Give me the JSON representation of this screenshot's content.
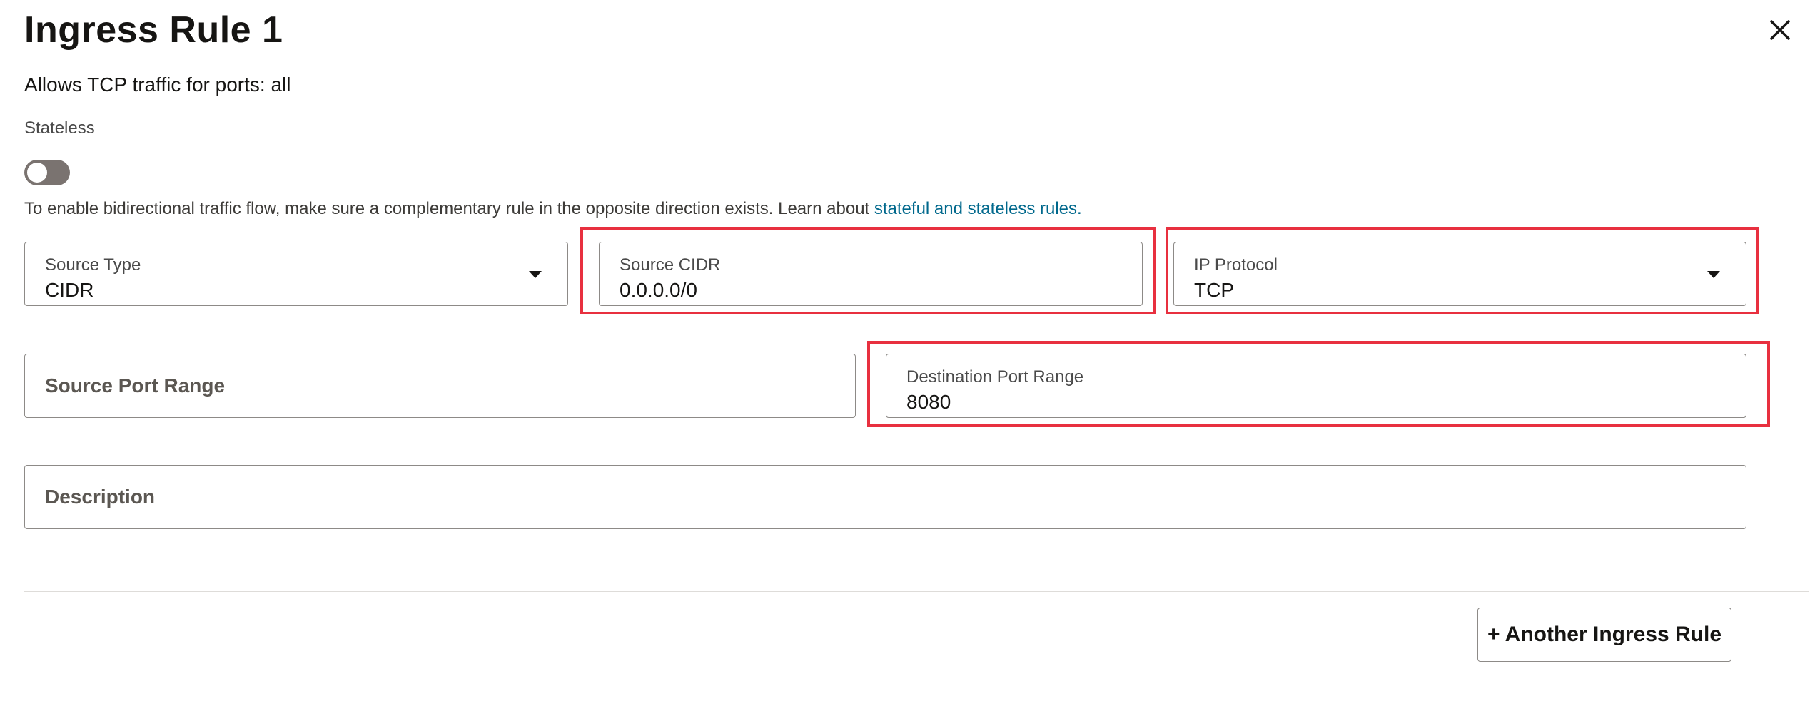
{
  "header": {
    "title": "Ingress Rule 1",
    "close_icon": "close-icon"
  },
  "summary": "Allows TCP traffic for ports: all",
  "stateless": {
    "label": "Stateless",
    "enabled": false
  },
  "help": {
    "text": "To enable bidirectional traffic flow, make sure a complementary rule in the opposite direction exists. Learn about ",
    "link_text": "stateful and stateless rules."
  },
  "fields": {
    "source_type": {
      "label": "Source Type",
      "value": "CIDR"
    },
    "source_cidr": {
      "label": "Source CIDR",
      "value": "0.0.0.0/0"
    },
    "ip_protocol": {
      "label": "IP Protocol",
      "value": "TCP"
    },
    "source_port_range": {
      "label": "Source Port Range",
      "value": ""
    },
    "destination_port_range": {
      "label": "Destination Port Range",
      "value": "8080"
    },
    "description": {
      "label": "Description",
      "value": ""
    }
  },
  "actions": {
    "add_another_label": "+ Another Ingress Rule"
  },
  "colors": {
    "highlight": "#e8303f",
    "link": "#00688c",
    "toggle_off": "#7a7370",
    "field_border": "#8d8a87"
  }
}
